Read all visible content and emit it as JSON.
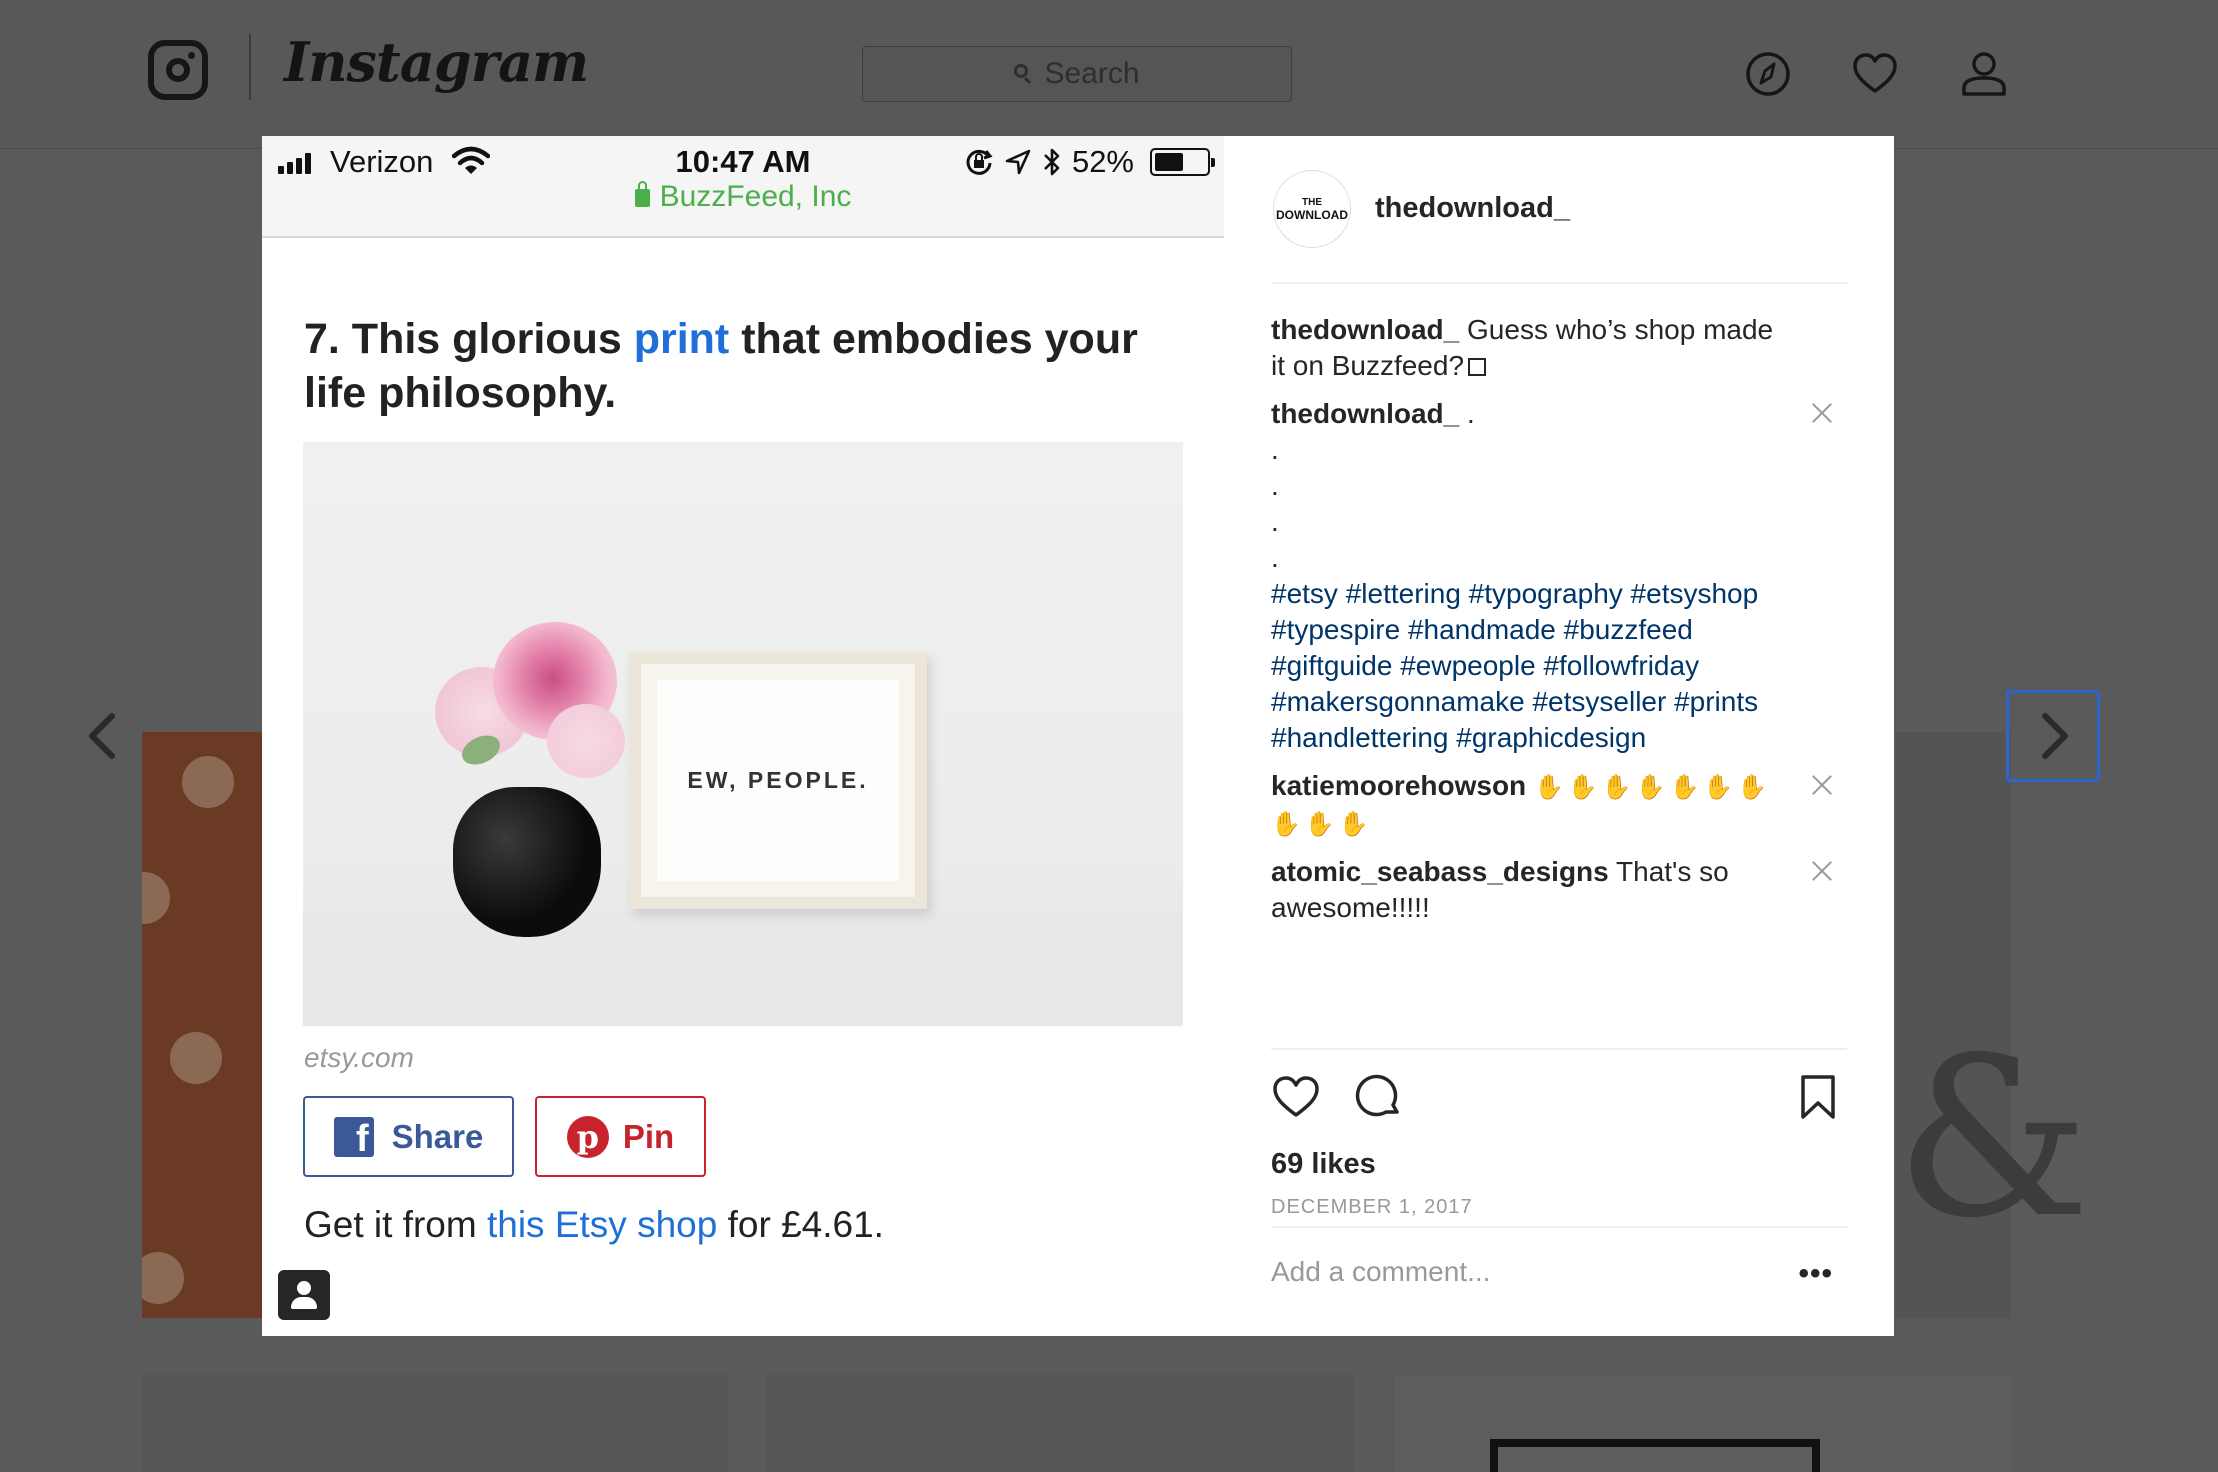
{
  "topbar": {
    "wordmark": "Instagram",
    "search_placeholder": "Search",
    "icons": [
      "instagram-logo-icon",
      "compass-icon",
      "heart-icon",
      "profile-icon"
    ]
  },
  "phone": {
    "carrier": "Verizon",
    "time": "10:47 AM",
    "site": "BuzzFeed, Inc",
    "battery": "52%",
    "headline_pre": "7. This glorious ",
    "headline_link": "print",
    "headline_post": " that embodies your life philosophy.",
    "print_text": "EW, PEOPLE.",
    "source": "etsy.com",
    "share_label": "Share",
    "pin_label": "Pin",
    "get_pre": "Get it from ",
    "get_link": "this Etsy shop",
    "get_post": " for £4.61."
  },
  "post": {
    "owner": "thedownload_",
    "avatar_line1": "THE",
    "avatar_line2": "DOWNLOAD",
    "caption_user": "thedownload_",
    "caption_text": " Guess who’s shop made it on Buzzfeed?",
    "comment2_user": "thedownload_",
    "comment2_text": " .",
    "dots": [
      ".",
      ".",
      ".",
      "."
    ],
    "hashtags": "#etsy #lettering #typography #etsyshop #typespire #handmade #buzzfeed #giftguide #ewpeople #followfriday #makersgonnamake #etsyseller #prints #handlettering #graphicdesign",
    "comment3_user": "katiemoorehowson",
    "comment3_clap_count": 10,
    "comment4_user": "atomic_seabass_designs",
    "comment4_text": " That's so awesome!!!!!",
    "likes": "69 likes",
    "date": "DECEMBER 1, 2017",
    "add_comment_placeholder": "Add a comment...",
    "more_label": "•••"
  },
  "colors": {
    "link_blue": "#1f6fd6",
    "hashtag_blue": "#003569",
    "facebook": "#3b5998",
    "pinterest": "#c8232c",
    "secure_green": "#4cb04a",
    "focus_border": "#2a66d0"
  }
}
